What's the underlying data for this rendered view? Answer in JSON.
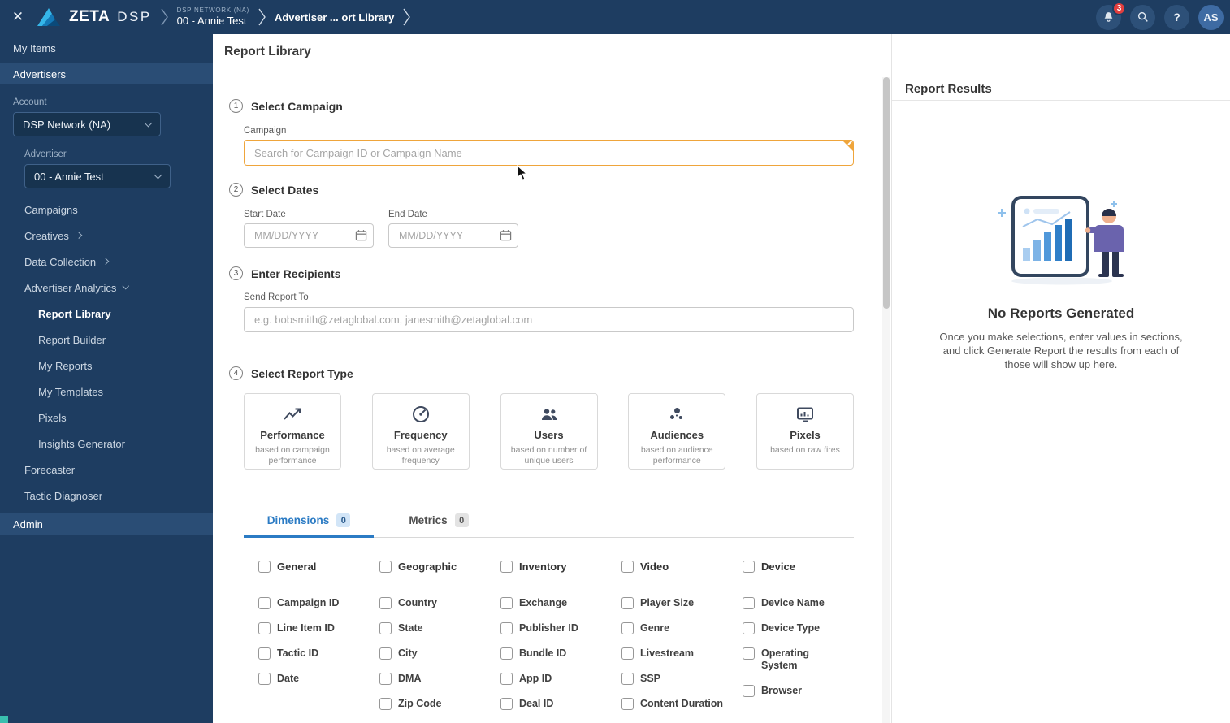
{
  "topbar": {
    "brand_zeta": "ZETA",
    "brand_dsp": "DSP",
    "crumb_network_label": "DSP NETWORK (NA)",
    "crumb_account": "00 - Annie Test",
    "crumb_page": "Advertiser ... ort Library",
    "notification_count": "3",
    "help_glyph": "?",
    "avatar_initials": "AS"
  },
  "sidebar": {
    "my_items": "My Items",
    "advertisers": "Advertisers",
    "account_label": "Account",
    "account_value": "DSP Network (NA)",
    "advertiser_label": "Advertiser",
    "advertiser_value": "00 - Annie Test",
    "nav": {
      "campaigns": "Campaigns",
      "creatives": "Creatives",
      "data_collection": "Data Collection",
      "advertiser_analytics": "Advertiser Analytics",
      "report_library": "Report Library",
      "report_builder": "Report Builder",
      "my_reports": "My Reports",
      "my_templates": "My Templates",
      "pixels": "Pixels",
      "insights_generator": "Insights Generator",
      "forecaster": "Forecaster",
      "tactic_diagnoser": "Tactic Diagnoser",
      "admin": "Admin"
    }
  },
  "main": {
    "title": "Report Library",
    "step1": {
      "num": "1",
      "title": "Select Campaign",
      "field_label": "Campaign",
      "placeholder": "Search for Campaign ID or Campaign Name"
    },
    "step2": {
      "num": "2",
      "title": "Select Dates",
      "start_label": "Start Date",
      "end_label": "End Date",
      "date_placeholder": "MM/DD/YYYY"
    },
    "step3": {
      "num": "3",
      "title": "Enter Recipients",
      "field_label": "Send Report To",
      "placeholder": "e.g. bobsmith@zetaglobal.com, janesmith@zetaglobal.com"
    },
    "step4": {
      "num": "4",
      "title": "Select Report Type"
    },
    "report_types": [
      {
        "name": "Performance",
        "desc": "based on campaign performance"
      },
      {
        "name": "Frequency",
        "desc": "based on average frequency"
      },
      {
        "name": "Users",
        "desc": "based on number of unique users"
      },
      {
        "name": "Audiences",
        "desc": "based on audience performance"
      },
      {
        "name": "Pixels",
        "desc": "based on raw fires"
      }
    ],
    "tabs": [
      {
        "label": "Dimensions",
        "count": "0"
      },
      {
        "label": "Metrics",
        "count": "0"
      }
    ],
    "groups": [
      {
        "name": "General",
        "items": [
          "Campaign ID",
          "Line Item ID",
          "Tactic ID",
          "Date"
        ]
      },
      {
        "name": "Geographic",
        "items": [
          "Country",
          "State",
          "City",
          "DMA",
          "Zip Code"
        ]
      },
      {
        "name": "Inventory",
        "items": [
          "Exchange",
          "Publisher ID",
          "Bundle ID",
          "App ID",
          "Deal ID"
        ]
      },
      {
        "name": "Video",
        "items": [
          "Player Size",
          "Genre",
          "Livestream",
          "SSP",
          "Content Duration"
        ]
      },
      {
        "name": "Device",
        "items": [
          "Device Name",
          "Device Type",
          "Operating System",
          "Browser"
        ]
      }
    ]
  },
  "results": {
    "title": "Report Results",
    "empty_title": "No Reports Generated",
    "empty_text": "Once you make selections, enter values in sections, and click Generate Report the results from each of those will show up here."
  },
  "colors": {
    "navy": "#1e3d61",
    "navy_highlight": "#2a4d75",
    "accent_blue": "#2b7bc4",
    "focus_orange": "#efa53b",
    "badge_red": "#e23e3e"
  }
}
